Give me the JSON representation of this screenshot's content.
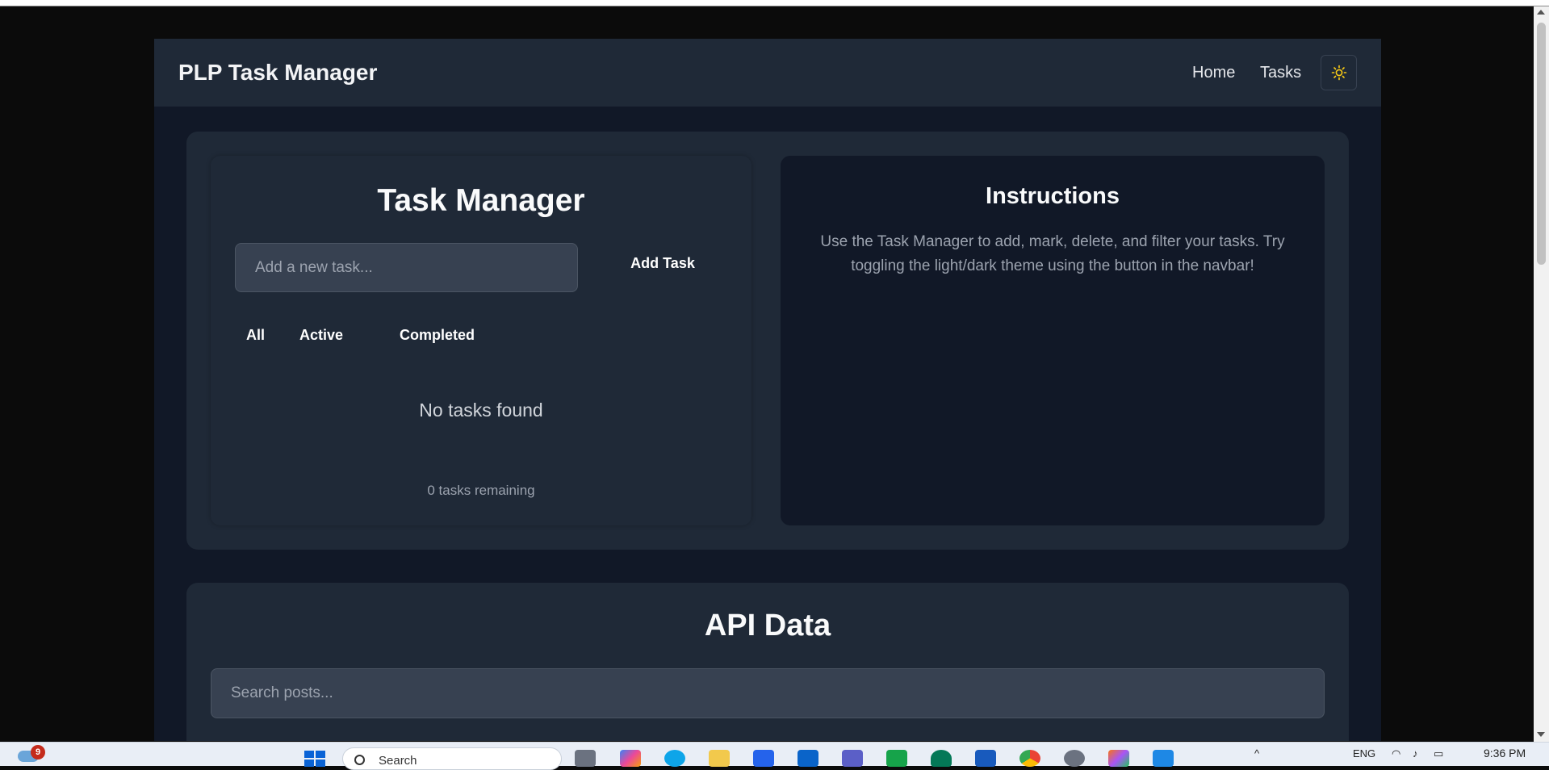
{
  "navbar": {
    "brand": "PLP Task Manager",
    "links": [
      "Home",
      "Tasks"
    ],
    "theme_icon": "sun-icon"
  },
  "task_manager": {
    "title": "Task Manager",
    "input_placeholder": "Add a new task...",
    "add_button": "Add Task",
    "filters": [
      "All",
      "Active",
      "Completed"
    ],
    "empty_message": "No tasks found",
    "remaining": "0 tasks remaining"
  },
  "instructions": {
    "title": "Instructions",
    "text": "Use the Task Manager to add, mark, delete, and filter your tasks. Try toggling the light/dark theme using the button in the navbar!"
  },
  "api": {
    "title": "API Data",
    "search_placeholder": "Search posts..."
  },
  "taskbar": {
    "notification_count": "9",
    "search_label": "Search",
    "language": "ENG",
    "time": "9:36 PM"
  },
  "colors": {
    "page_bg": "#111827",
    "card_bg": "#1f2937",
    "input_bg": "#374151",
    "accent_sun": "#facc15"
  }
}
